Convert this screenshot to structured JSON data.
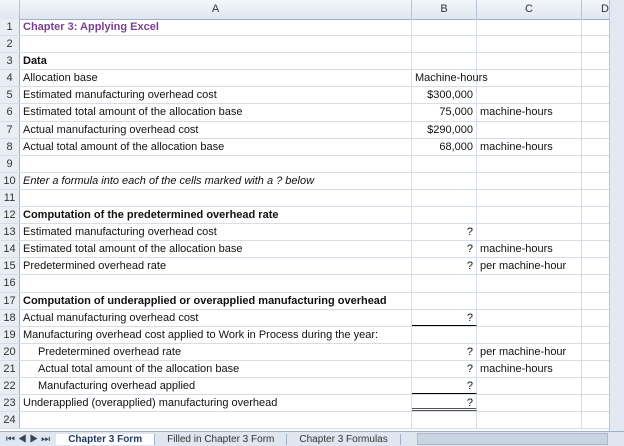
{
  "columns": [
    "A",
    "B",
    "C",
    "D"
  ],
  "rows": [
    {
      "n": "1",
      "a": "Chapter 3: Applying Excel",
      "b": "",
      "c": ""
    },
    {
      "n": "2",
      "a": "",
      "b": "",
      "c": ""
    },
    {
      "n": "3",
      "a": "Data",
      "b": "",
      "c": ""
    },
    {
      "n": "4",
      "a": "Allocation base",
      "b": "Machine-hours",
      "c": ""
    },
    {
      "n": "5",
      "a": "Estimated manufacturing overhead cost",
      "b": "$300,000",
      "c": ""
    },
    {
      "n": "6",
      "a": "Estimated total amount of the allocation base",
      "b": "75,000",
      "c": "machine-hours"
    },
    {
      "n": "7",
      "a": "Actual manufacturing overhead cost",
      "b": "$290,000",
      "c": ""
    },
    {
      "n": "8",
      "a": "Actual total amount of the allocation base",
      "b": "68,000",
      "c": "machine-hours"
    },
    {
      "n": "9",
      "a": "",
      "b": "",
      "c": ""
    },
    {
      "n": "10",
      "a": "Enter a formula into each of the cells marked with a ? below",
      "b": "",
      "c": ""
    },
    {
      "n": "11",
      "a": "",
      "b": "",
      "c": ""
    },
    {
      "n": "12",
      "a": "Computation of the predetermined overhead rate",
      "b": "",
      "c": ""
    },
    {
      "n": "13",
      "a": "Estimated manufacturing overhead cost",
      "b": "?",
      "c": ""
    },
    {
      "n": "14",
      "a": "Estimated total amount of the allocation base",
      "b": "?",
      "c": "machine-hours"
    },
    {
      "n": "15",
      "a": "Predetermined overhead rate",
      "b": "?",
      "c": "per machine-hour"
    },
    {
      "n": "16",
      "a": "",
      "b": "",
      "c": ""
    },
    {
      "n": "17",
      "a": "Computation of underapplied or overapplied manufacturing overhead",
      "b": "",
      "c": ""
    },
    {
      "n": "18",
      "a": "Actual manufacturing overhead cost",
      "b": "?",
      "c": ""
    },
    {
      "n": "19",
      "a": "Manufacturing overhead cost applied to Work in Process during the year:",
      "b": "",
      "c": ""
    },
    {
      "n": "20",
      "a": "Predetermined overhead rate",
      "b": "?",
      "c": "per machine-hour"
    },
    {
      "n": "21",
      "a": "Actual total amount of the allocation base",
      "b": "?",
      "c": "machine-hours"
    },
    {
      "n": "22",
      "a": "Manufacturing overhead applied",
      "b": "?",
      "c": ""
    },
    {
      "n": "23",
      "a": "Underapplied (overapplied) manufacturing overhead",
      "b": "?",
      "c": ""
    },
    {
      "n": "24",
      "a": "",
      "b": "",
      "c": ""
    }
  ],
  "sheet_tabs": [
    "Chapter 3 Form",
    "Filled in Chapter 3 Form",
    "Chapter 3 Formulas"
  ]
}
